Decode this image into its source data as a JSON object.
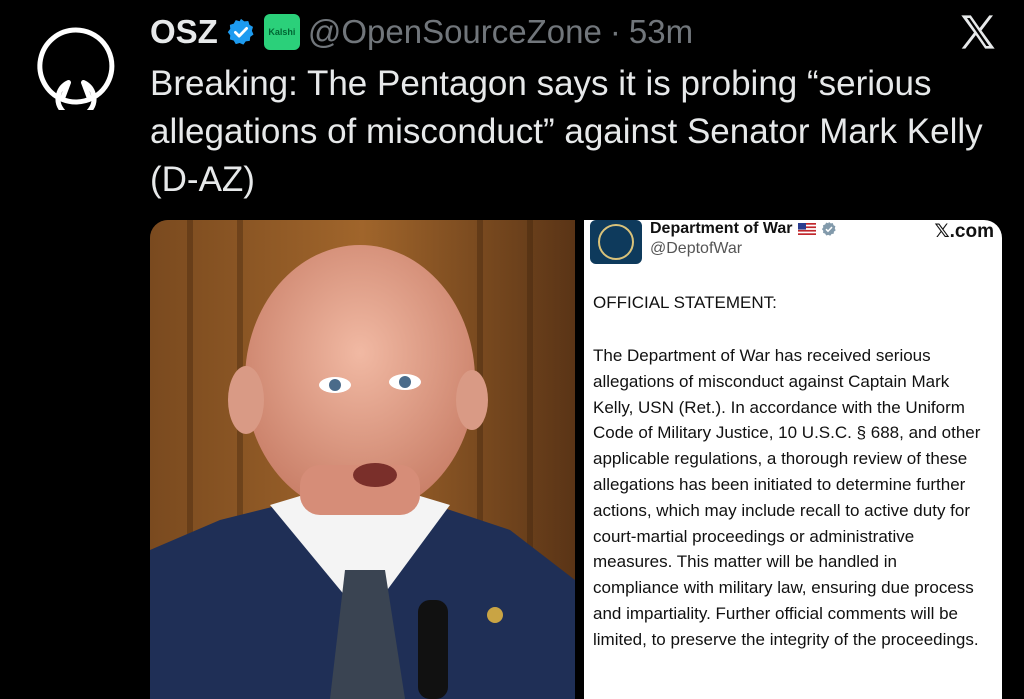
{
  "tweet": {
    "display_name": "OSZ",
    "badge_label": "Kalshi",
    "handle": "@OpenSourceZone",
    "separator": "·",
    "time": "53m",
    "text": "Breaking: The Pentagon says it is probing “serious allegations of misconduct” against Senator Mark Kelly (D-AZ)"
  },
  "embedded_post": {
    "account_name": "Department of War",
    "account_handle": "@DeptofWar",
    "source": "𝕏.com",
    "title": "OFFICIAL STATEMENT:",
    "body": "The Department of War has received serious allegations of misconduct against Captain Mark Kelly, USN (Ret.). In accordance with the Uniform Code of Military Justice, 10 U.S.C. § 688, and other applicable regulations, a thorough review of these allegations has been initiated to determine further actions, which may include recall to active duty for court-martial proceedings or administrative measures. This matter will be handled in compliance with military law, ensuring due process and impartiality. Further official comments will be limited, to preserve the integrity of the proceedings."
  },
  "colors": {
    "background": "#000000",
    "text": "#e7e9ea",
    "muted": "#71767b",
    "verified_blue": "#1d9bf0",
    "kalshi_green": "#2bd07a"
  },
  "icons": {
    "avatar": "open-source-keyhole-icon",
    "verified": "verified-check-icon",
    "close": "x-logo-icon"
  }
}
